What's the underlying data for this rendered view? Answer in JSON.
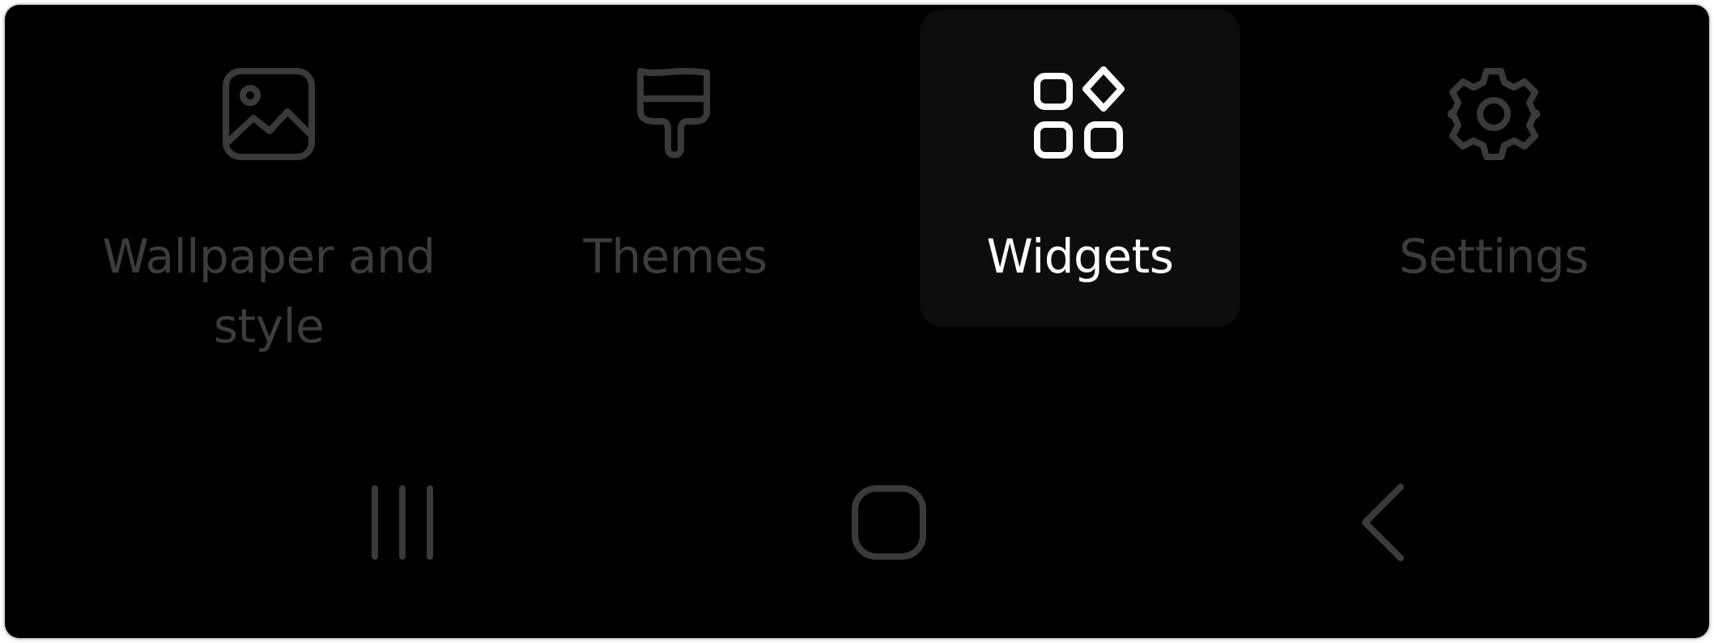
{
  "menu": {
    "items": [
      {
        "id": "wallpaper",
        "label": "Wallpaper and style",
        "icon": "image-icon",
        "selected": false
      },
      {
        "id": "themes",
        "label": "Themes",
        "icon": "paintbrush-icon",
        "selected": false
      },
      {
        "id": "widgets",
        "label": "Widgets",
        "icon": "widgets-icon",
        "selected": true
      },
      {
        "id": "settings",
        "label": "Settings",
        "icon": "gear-icon",
        "selected": false
      }
    ]
  },
  "nav_bar": {
    "buttons": [
      {
        "id": "recents",
        "icon": "recents-icon"
      },
      {
        "id": "home",
        "icon": "home-icon"
      },
      {
        "id": "back",
        "icon": "back-icon"
      }
    ]
  },
  "colors": {
    "background": "#000000",
    "selected_tile": "#0d0d0f",
    "selected_text": "#ffffff",
    "dim_text": "#3c3c3c",
    "dim_icon": "#3a3a3a",
    "nav_icon": "#3a3a3a"
  }
}
